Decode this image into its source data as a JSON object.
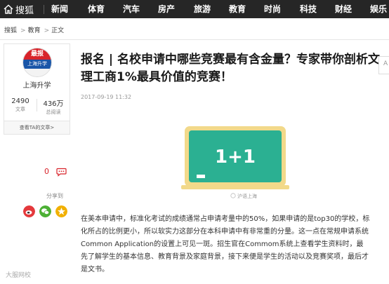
{
  "topnav": {
    "brand": "搜狐",
    "items": [
      "新闻",
      "体育",
      "汽车",
      "房产",
      "旅游",
      "教育",
      "时尚",
      "科技",
      "财经",
      "娱乐"
    ]
  },
  "breadcrumb": [
    "搜狐",
    "教育",
    "正文"
  ],
  "author": {
    "avatar_top": "最报",
    "avatar_mid": "上海升学",
    "name": "上海升学",
    "articles_count": "2490",
    "articles_label": "文章",
    "views_count": "436万",
    "views_label": "总阅读",
    "view_all": "查看TA的文章>"
  },
  "article": {
    "title": "报名 | 名校申请中哪些竞赛最有含金量？专家带你剖析文理工商1%最具价值的竞赛！",
    "date": "2017-09-19 11:32",
    "board_text": "1+1",
    "board_caption": "沪语上海",
    "body": "在美本申请中，标准化考试的成绩通常占申请考量中的50%，如果申请的是top30的学校，标化所占的比例更小，所以软实力这部分在本科申请中有非常重的分量。这一点在常规申请系统Common Application的设置上可见一斑。招生官在Commom系统上查看学生资料时，最先了解学生的基本信息、教育背景及家庭背景，接下来便是学生的活动以及竞赛奖项，最后才是文书。"
  },
  "sidebar": {
    "likes": "0",
    "share_label": "分享到"
  },
  "right_edge": "A",
  "watermark": "大服网校",
  "colors": {
    "nav_bg": "#262626",
    "brand_red": "#d8232a",
    "board_green": "#2bb092",
    "board_frame": "#f2d98a"
  }
}
